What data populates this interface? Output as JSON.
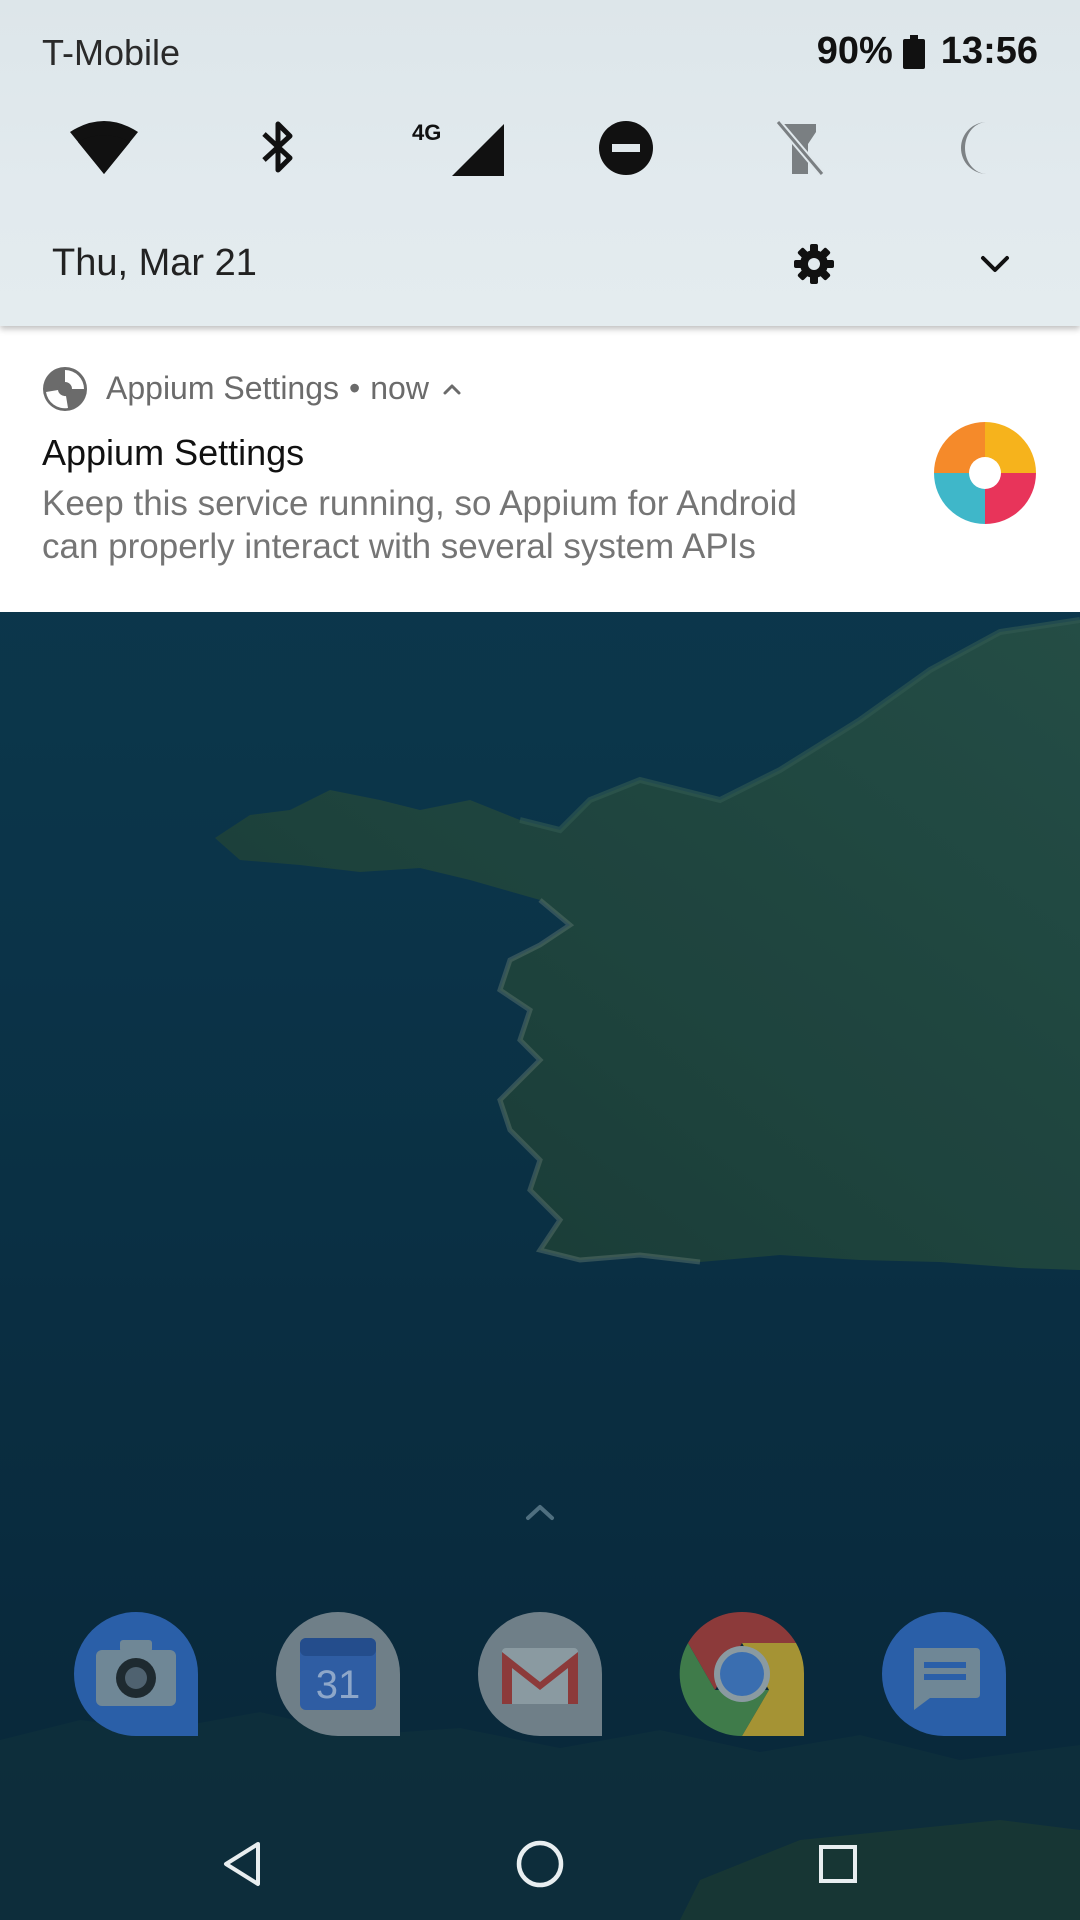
{
  "status_bar": {
    "carrier": "T-Mobile",
    "battery": "90%",
    "time": "13:56"
  },
  "quick_settings": {
    "tiles": [
      {
        "name": "wifi",
        "icon": "wifi-icon"
      },
      {
        "name": "bluetooth",
        "icon": "bluetooth-icon"
      },
      {
        "name": "mobile-data",
        "icon": "signal-icon",
        "label": "4G"
      },
      {
        "name": "do-not-disturb",
        "icon": "do-not-disturb-icon"
      },
      {
        "name": "flashlight",
        "icon": "flashlight-off-icon"
      },
      {
        "name": "night-light",
        "icon": "moon-icon"
      }
    ],
    "date": "Thu, Mar 21"
  },
  "notification": {
    "app_name": "Appium Settings",
    "separator": "•",
    "time": "now",
    "title": "Appium Settings",
    "text": "Keep this service running, so Appium for Android can properly interact with several system APIs"
  },
  "dock": {
    "apps": [
      {
        "name": "camera",
        "icon": "camera-icon"
      },
      {
        "name": "calendar",
        "icon": "calendar-icon",
        "label": "31"
      },
      {
        "name": "gmail",
        "icon": "gmail-icon"
      },
      {
        "name": "chrome",
        "icon": "chrome-icon"
      },
      {
        "name": "messages",
        "icon": "messages-icon"
      }
    ]
  },
  "nav_bar": {
    "buttons": [
      "back",
      "home",
      "recents"
    ]
  },
  "colors": {
    "shade_bg": "#e0e8ec",
    "notification_bg": "#ffffff",
    "wallpaper_sea": "#0d3f56",
    "wallpaper_land": "#2a5a4e"
  }
}
